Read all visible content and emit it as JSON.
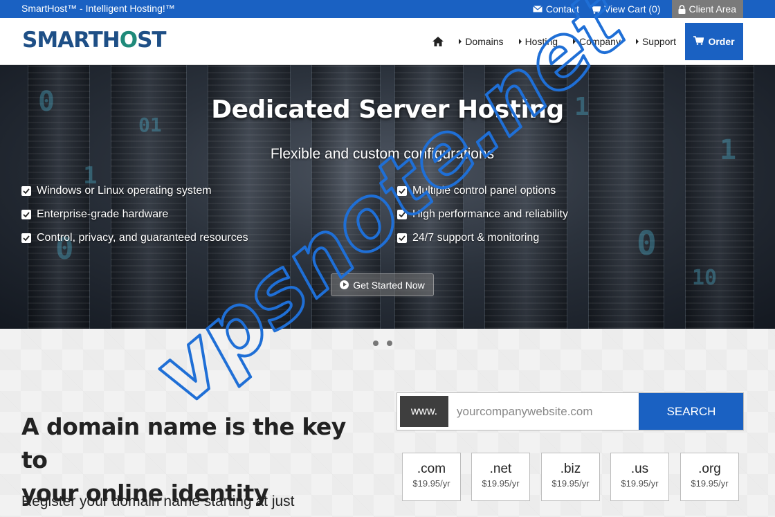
{
  "topbar": {
    "tagline": "SmartHost™ - Intelligent Hosting!™",
    "contact": "Contact",
    "view_cart": "View Cart (0)",
    "client_area": "Client Area"
  },
  "header": {
    "logo_left": "SMARTH",
    "logo_o": "O",
    "logo_right": "ST",
    "nav": [
      "Domains",
      "Hosting",
      "Company",
      "Support"
    ],
    "order": "Order"
  },
  "hero": {
    "title": "Dedicated Server Hosting",
    "subtitle": "Flexible and custom configurations",
    "features_left": [
      "Windows or Linux operating system",
      "Enterprise-grade hardware",
      "Control, privacy, and guaranteed resources"
    ],
    "features_right": [
      "Multiple control panel options",
      "High performance and reliability",
      "24/7 support & monitoring"
    ],
    "cta": "Get Started Now"
  },
  "domain": {
    "heading_line1": "A domain name is the key to",
    "heading_line2": "your online identity",
    "subtext": "Register your domain name starting at just",
    "www": "www.",
    "placeholder": "yourcompanywebsite.com",
    "search_button": "SEARCH",
    "tlds": [
      {
        "name": ".com",
        "price": "$19.95/yr"
      },
      {
        "name": ".net",
        "price": "$19.95/yr"
      },
      {
        "name": ".biz",
        "price": "$19.95/yr"
      },
      {
        "name": ".us",
        "price": "$19.95/yr"
      },
      {
        "name": ".org",
        "price": "$19.95/yr"
      }
    ]
  },
  "watermark": "vpsnote.net",
  "colors": {
    "brand_blue": "#1a61c2",
    "logo_navy": "#1e4f86",
    "logo_teal": "#1f8a7a"
  }
}
